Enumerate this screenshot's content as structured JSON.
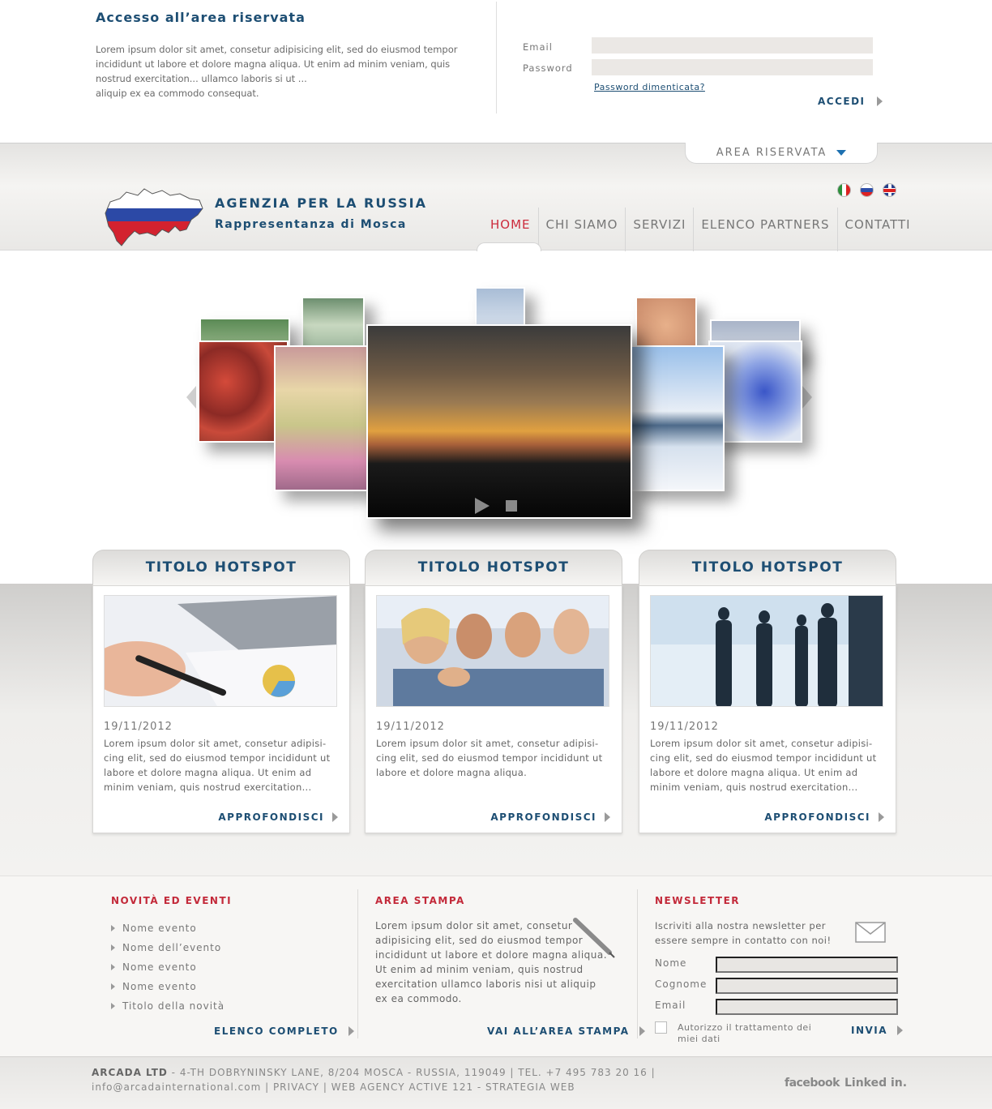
{
  "login": {
    "title": "Accesso all’area riservata",
    "text": "Lorem ipsum dolor sit amet, consetur adipisicing elit, sed do eiusmod tempor\nincididunt ut labore et dolore magna aliqua.  Ut enim ad minim veniam, quis\nnostrud exercitation... ullamco laboris si ut ...\naliquip ex ea commodo consequat.",
    "email_label": "Email",
    "password_label": "Password",
    "forgot": "Password dimenticata?",
    "submit": "ACCEDI"
  },
  "header": {
    "area_tab": "AREA RISERVATA",
    "logo_line1": "AGENZIA PER LA RUSSIA",
    "logo_line2": "Rappresentanza di Mosca",
    "flags": [
      "italian-flag-icon",
      "russian-flag-icon",
      "uk-flag-icon"
    ],
    "nav": [
      "HOME",
      "CHI SIAMO",
      "SERVIZI",
      "ELENCO PARTNERS",
      "CONTATTI"
    ],
    "active_nav": "HOME"
  },
  "carousel": {
    "icons": [
      "play-icon",
      "stop-icon",
      "prev-arrow-icon",
      "next-arrow-icon"
    ]
  },
  "hotspots": [
    {
      "title": "TITOLO HOTSPOT",
      "date": "19/11/2012",
      "text": "Lorem ipsum dolor sit amet, consetur adipisi-cing elit, sed do eiusmod tempor  incididunt ut labore et dolore magna aliqua.  Ut enim ad minim veniam, quis nostrud exercitation...",
      "more": "APPROFONDISCI"
    },
    {
      "title": "TITOLO HOTSPOT",
      "date": "19/11/2012",
      "text": "Lorem ipsum dolor sit amet, consetur adipisi-cing elit, sed do eiusmod tempor  incididunt ut labore et dolore magna aliqua.",
      "more": "APPROFONDISCI"
    },
    {
      "title": "TITOLO HOTSPOT",
      "date": "19/11/2012",
      "text": "Lorem ipsum dolor sit amet, consetur adipisi-cing elit, sed do eiusmod tempor  incididunt ut labore et dolore magna aliqua.  Ut enim ad minim veniam, quis nostrud exercitation...",
      "more": "APPROFONDISCI"
    }
  ],
  "news": {
    "title": "NOVITÀ ED EVENTI",
    "items": [
      "Nome evento",
      "Nome dell’evento",
      "Nome evento",
      "Nome evento",
      "Titolo della novità"
    ],
    "link": "ELENCO COMPLETO"
  },
  "press": {
    "title": "AREA STAMPA",
    "text": "Lorem ipsum dolor sit amet, consetur adipisicing elit, sed do eiusmod tempor  incididunt ut labore et dolore magna aliqua.  Ut enim ad minim veniam, quis nostrud exercitation ullamco laboris nisi ut aliquip ex ea commodo.",
    "link": "VAI ALL’AREA STAMPA"
  },
  "newsletter": {
    "title": "NEWSLETTER",
    "text": "Iscriviti alla nostra newsletter per essere sempre in contatto con noi!",
    "nome": "Nome",
    "cognome": "Cognome",
    "email": "Email",
    "consent": "Autorizzo il trattamento dei miei dati",
    "submit": "INVIA"
  },
  "footer": {
    "company": "ARCADA LTD",
    "address": " - 4-TH DOBRYNINSKY LANE, 8/204 MOSCA - RUSSIA, 119049   |   TEL. +7 495 783 20 16   |",
    "line2": "info@arcadainternational.com   |   PRIVACY   |   WEB AGENCY ACTIVE 121 - STRATEGIA WEB",
    "facebook": "facebook",
    "linkedin": "Linked in."
  },
  "colors": {
    "brand_blue": "#1d4e73",
    "accent_red": "#cc2b3c"
  }
}
